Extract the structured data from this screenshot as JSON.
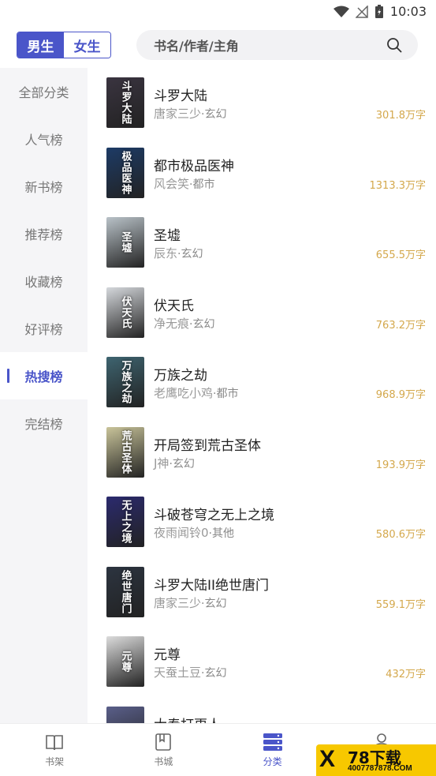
{
  "status_bar": {
    "time": "10:03"
  },
  "header": {
    "gender_tabs": [
      {
        "label": "男生",
        "active": true
      },
      {
        "label": "女生",
        "active": false
      }
    ],
    "search_placeholder": "书名/作者/主角"
  },
  "sidebar": {
    "items": [
      {
        "label": "全部分类",
        "active": false
      },
      {
        "label": "人气榜",
        "active": false
      },
      {
        "label": "新书榜",
        "active": false
      },
      {
        "label": "推荐榜",
        "active": false
      },
      {
        "label": "收藏榜",
        "active": false
      },
      {
        "label": "好评榜",
        "active": false
      },
      {
        "label": "热搜榜",
        "active": true
      },
      {
        "label": "完结榜",
        "active": false
      }
    ]
  },
  "books": [
    {
      "title": "斗罗大陆",
      "author": "唐家三少",
      "category": "玄幻",
      "words": "301.8万字",
      "cover_text": "斗罗大陆",
      "cover_color": "#3a3440"
    },
    {
      "title": "都市极品医神",
      "author": "风会笑",
      "category": "都市",
      "words": "1313.3万字",
      "cover_text": "极品医神",
      "cover_color": "#1d3b66"
    },
    {
      "title": "圣墟",
      "author": "辰东",
      "category": "玄幻",
      "words": "655.5万字",
      "cover_text": "圣墟",
      "cover_color": "#b9c2c8"
    },
    {
      "title": "伏天氏",
      "author": "净无痕",
      "category": "玄幻",
      "words": "763.2万字",
      "cover_text": "伏天氏",
      "cover_color": "#d5d8dc"
    },
    {
      "title": "万族之劫",
      "author": "老鹰吃小鸡",
      "category": "都市",
      "words": "968.9万字",
      "cover_text": "万族之劫",
      "cover_color": "#3e6470"
    },
    {
      "title": "开局签到荒古圣体",
      "author": "J神",
      "category": "玄幻",
      "words": "193.9万字",
      "cover_text": "荒古圣体",
      "cover_color": "#c9c49a"
    },
    {
      "title": "斗破苍穹之无上之境",
      "author": "夜雨闻铃0",
      "category": "其他",
      "words": "580.6万字",
      "cover_text": "无上之境",
      "cover_color": "#2b2a6e"
    },
    {
      "title": "斗罗大陆II绝世唐门",
      "author": "唐家三少",
      "category": "玄幻",
      "words": "559.1万字",
      "cover_text": "绝世唐门",
      "cover_color": "#2c3440"
    },
    {
      "title": "元尊",
      "author": "天蚕土豆",
      "category": "玄幻",
      "words": "432万字",
      "cover_text": "元尊",
      "cover_color": "#dcdcdc"
    },
    {
      "title": "大奉打更人",
      "author": "",
      "category": "",
      "words": "",
      "cover_text": "",
      "cover_color": "#5a5f8a"
    }
  ],
  "bottom_nav": [
    {
      "label": "书架",
      "icon": "bookshelf-icon",
      "active": false
    },
    {
      "label": "书城",
      "icon": "bookstore-icon",
      "active": false
    },
    {
      "label": "分类",
      "icon": "category-icon",
      "active": true
    },
    {
      "label": "我的",
      "icon": "profile-icon",
      "active": false
    }
  ],
  "watermark": {
    "main": "78下载",
    "url": "4007787878.COM",
    "x": "X"
  },
  "colors": {
    "accent": "#4a55c9",
    "words": "#d4a84c"
  }
}
